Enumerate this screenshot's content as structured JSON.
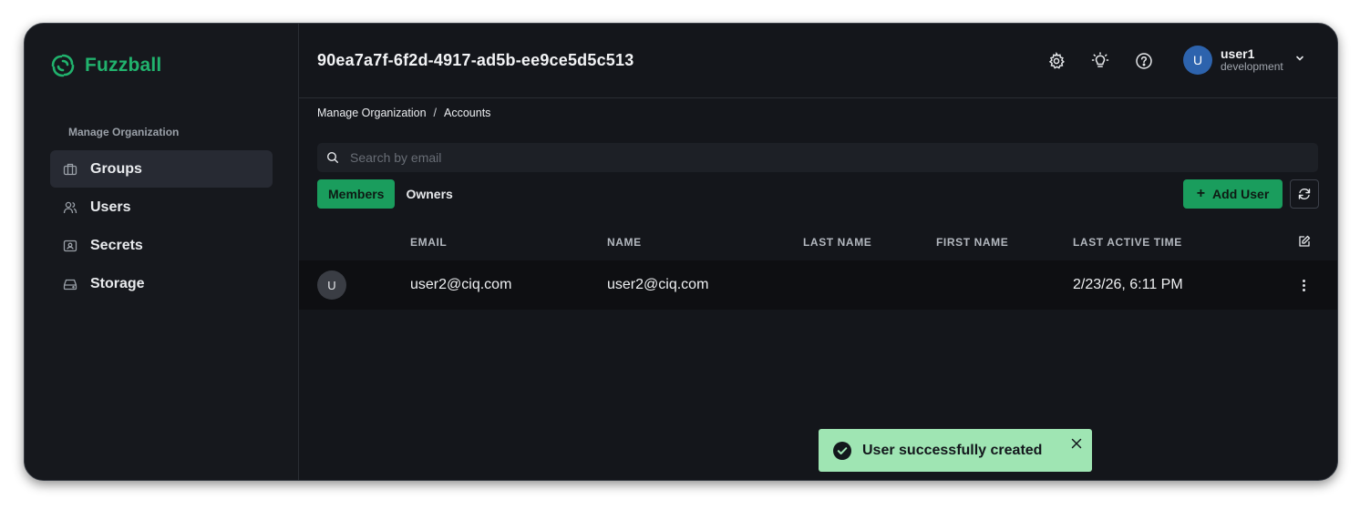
{
  "app": {
    "name": "Fuzzball"
  },
  "sidebar": {
    "section_label": "Manage Organization",
    "items": [
      {
        "label": "Groups",
        "icon": "briefcase-icon",
        "active": true
      },
      {
        "label": "Users",
        "icon": "users-icon"
      },
      {
        "label": "Secrets",
        "icon": "secret-icon"
      },
      {
        "label": "Storage",
        "icon": "storage-icon"
      }
    ]
  },
  "header": {
    "title": "90ea7a7f-6f2d-4917-ad5b-ee9ce5d5c513",
    "icons": [
      "gear-icon",
      "lightbulb-icon",
      "help-icon"
    ],
    "user": {
      "avatar_initial": "U",
      "name": "user1",
      "environment": "development"
    }
  },
  "breadcrumb": {
    "items": [
      "Manage Organization",
      "Accounts"
    ],
    "separator": "/"
  },
  "search": {
    "placeholder": "Search by email",
    "value": ""
  },
  "tabs": [
    {
      "label": "Members",
      "active": true
    },
    {
      "label": "Owners",
      "active": false
    }
  ],
  "toolbar": {
    "add_user_label": "Add User",
    "refresh_icon": "refresh-icon"
  },
  "table": {
    "columns": [
      "EMAIL",
      "NAME",
      "LAST NAME",
      "FIRST NAME",
      "LAST ACTIVE TIME"
    ],
    "rows": [
      {
        "avatar_initial": "U",
        "email": "user2@ciq.com",
        "name": "user2@ciq.com",
        "last_name": "",
        "first_name": "",
        "last_active": "2/23/26, 6:11 PM"
      }
    ]
  },
  "toast": {
    "message": "User successfully created",
    "icon": "check-circle-icon"
  },
  "colors": {
    "accent": "#1a9d5d",
    "background": "#14161b",
    "toast_bg": "#9fe5b3",
    "avatar_blue": "#2d63ad"
  }
}
